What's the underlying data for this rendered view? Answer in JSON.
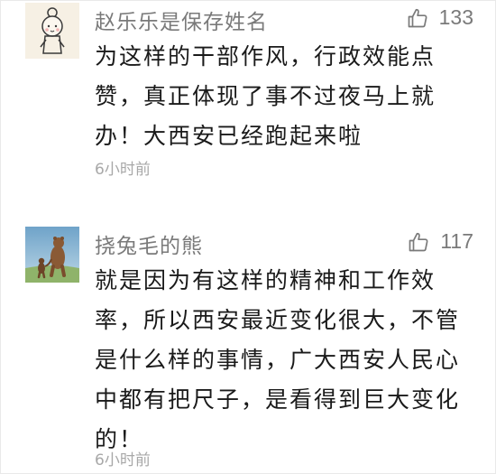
{
  "comments": [
    {
      "username": "赵乐乐是保存姓名",
      "likes": "133",
      "text": "为这样的干部作风，行政效能点赞，真正体现了事不过夜马上就办！大西安已经跑起来啦",
      "time": "6小时前",
      "avatar_icon": "girl-doodle-avatar-icon"
    },
    {
      "username": "挠兔毛的熊",
      "likes": "117",
      "text": "就是因为有这样的精神和工作效率，所以西安最近变化很大，不管是什么样的事情，广大西安人民心中都有把尺子，是看得到巨大变化的！",
      "time": "6小时前",
      "avatar_icon": "bears-walking-avatar-icon"
    }
  ],
  "colors": {
    "username": "#7a7a7a",
    "body_text": "#1a1a1a",
    "timestamp": "#a8a8a8"
  }
}
